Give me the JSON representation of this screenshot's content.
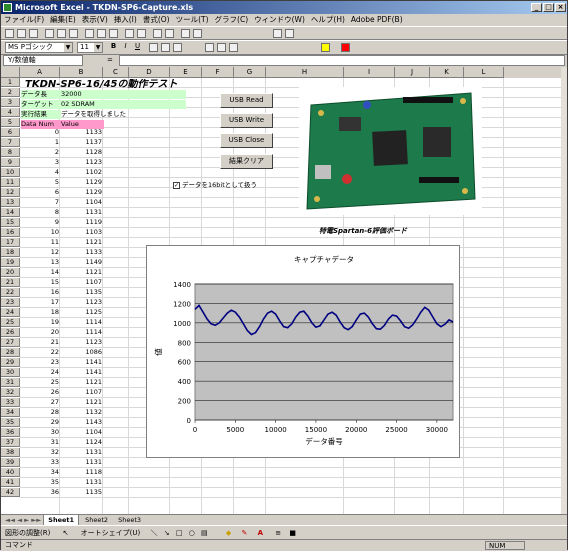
{
  "window": {
    "title": "Microsoft Excel - TKDN-SP6-Capture.xls"
  },
  "menu": [
    "ファイル(F)",
    "編集(E)",
    "表示(V)",
    "挿入(I)",
    "書式(O)",
    "ツール(T)",
    "グラフ(C)",
    "ウィンドウ(W)",
    "ヘルプ(H)",
    "Adobe PDF(B)"
  ],
  "format_toolbar": {
    "font_name": "MS Pゴシック",
    "font_size": "11"
  },
  "formula_bar": {
    "name_box": "Y/数値軸",
    "fx": "="
  },
  "columns": [
    "A",
    "B",
    "C",
    "D",
    "E",
    "F",
    "G",
    "H",
    "I",
    "J",
    "K",
    "L"
  ],
  "cells": {
    "title": "TKDN-SP6-16/45の動作テスト",
    "r2_label": "データ長",
    "r2_value": "32000",
    "r3_label": "ターゲット",
    "r3_value": "02 SDRAM",
    "r4_label": "実行結果",
    "r4_value": "データを取得しました",
    "hdr_num": "Data Num",
    "hdr_val": "Value"
  },
  "rows": [
    [
      0,
      1133
    ],
    [
      1,
      1137
    ],
    [
      2,
      1128
    ],
    [
      3,
      1123
    ],
    [
      4,
      1102
    ],
    [
      5,
      1129
    ],
    [
      6,
      1129
    ],
    [
      7,
      1104
    ],
    [
      8,
      1131
    ],
    [
      9,
      1119
    ],
    [
      10,
      1103
    ],
    [
      11,
      1121
    ],
    [
      12,
      1133
    ],
    [
      13,
      1149
    ],
    [
      14,
      1121
    ],
    [
      15,
      1107
    ],
    [
      16,
      1135
    ],
    [
      17,
      1123
    ],
    [
      18,
      1125
    ],
    [
      19,
      1114
    ],
    [
      20,
      1114
    ],
    [
      21,
      1123
    ],
    [
      22,
      1086
    ],
    [
      23,
      1141
    ],
    [
      24,
      1141
    ],
    [
      25,
      1121
    ],
    [
      26,
      1107
    ],
    [
      27,
      1121
    ],
    [
      28,
      1132
    ],
    [
      29,
      1143
    ],
    [
      30,
      1104
    ],
    [
      31,
      1124
    ],
    [
      32,
      1131
    ],
    [
      33,
      1131
    ],
    [
      34,
      1118
    ],
    [
      35,
      1131
    ],
    [
      36,
      1135
    ]
  ],
  "buttons": {
    "usb_read": "USB Read",
    "usb_write": "USB Write",
    "usb_close": "USB Close",
    "clear": "結果クリア"
  },
  "checkbox": {
    "label": "データを16bitとして扱う",
    "checked": true
  },
  "board_caption": "特電Spartan-6評価ボード",
  "sheet_tabs": [
    "Sheet1",
    "Sheet2",
    "Sheet3"
  ],
  "draw_toolbar": {
    "draw_label": "図形の調整(R)",
    "autoshape_label": "オートシェイプ(U)"
  },
  "status": {
    "mode": "コマンド",
    "num": "NUM"
  },
  "colors": {
    "label_green": "#ccffcc",
    "header_pink": "#ff99cc",
    "plot_bg": "#c0c0c0",
    "series": "#000080"
  },
  "chart_data": {
    "type": "line",
    "title": "キャプチャデータ",
    "xlabel": "データ番号",
    "ylabel": "値",
    "xlim": [
      0,
      32000
    ],
    "ylim": [
      0,
      1400
    ],
    "x_ticks": [
      0,
      5000,
      10000,
      15000,
      20000,
      25000,
      30000
    ],
    "y_ticks": [
      0,
      200,
      400,
      600,
      800,
      1000,
      1200,
      1400
    ],
    "series": [
      {
        "values": [
          [
            0,
            1140
          ],
          [
            500,
            1180
          ],
          [
            1000,
            1110
          ],
          [
            1500,
            1040
          ],
          [
            2000,
            990
          ],
          [
            2500,
            975
          ],
          [
            3000,
            1000
          ],
          [
            3500,
            1050
          ],
          [
            4000,
            1100
          ],
          [
            4500,
            1130
          ],
          [
            5000,
            1110
          ],
          [
            5500,
            1060
          ],
          [
            6000,
            990
          ],
          [
            6500,
            920
          ],
          [
            7000,
            880
          ],
          [
            7500,
            900
          ],
          [
            8000,
            960
          ],
          [
            8500,
            1040
          ],
          [
            9000,
            1100
          ],
          [
            9500,
            1120
          ],
          [
            10000,
            1090
          ],
          [
            10500,
            1020
          ],
          [
            11000,
            960
          ],
          [
            11500,
            950
          ],
          [
            12000,
            990
          ],
          [
            12500,
            1060
          ],
          [
            13000,
            1110
          ],
          [
            13500,
            1120
          ],
          [
            14000,
            1070
          ],
          [
            14500,
            1000
          ],
          [
            15000,
            955
          ],
          [
            15500,
            970
          ],
          [
            16000,
            1030
          ],
          [
            16500,
            1090
          ],
          [
            17000,
            1110
          ],
          [
            17500,
            1080
          ],
          [
            18000,
            1010
          ],
          [
            18500,
            950
          ],
          [
            19000,
            930
          ],
          [
            19500,
            960
          ],
          [
            20000,
            1030
          ],
          [
            20500,
            1090
          ],
          [
            21000,
            1100
          ],
          [
            21500,
            1060
          ],
          [
            22000,
            990
          ],
          [
            22500,
            940
          ],
          [
            23000,
            935
          ],
          [
            23500,
            975
          ],
          [
            24000,
            1040
          ],
          [
            24500,
            1080
          ],
          [
            25000,
            1070
          ],
          [
            25500,
            1020
          ],
          [
            26000,
            960
          ],
          [
            26500,
            945
          ],
          [
            27000,
            980
          ],
          [
            27500,
            1040
          ],
          [
            28000,
            1110
          ],
          [
            28500,
            1160
          ],
          [
            29000,
            1130
          ],
          [
            29500,
            1060
          ],
          [
            30000,
            990
          ],
          [
            30500,
            960
          ],
          [
            31000,
            985
          ],
          [
            31500,
            1030
          ],
          [
            32000,
            1010
          ]
        ]
      }
    ]
  }
}
